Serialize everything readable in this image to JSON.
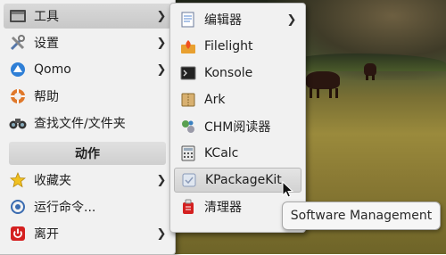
{
  "main_menu": {
    "items": [
      {
        "label": "工具",
        "icon": "tools-icon",
        "submenu": true
      },
      {
        "label": "设置",
        "icon": "settings-icon",
        "submenu": true
      },
      {
        "label": "Qomo",
        "icon": "qomo-icon",
        "submenu": true
      },
      {
        "label": "帮助",
        "icon": "help-icon",
        "submenu": false
      },
      {
        "label": "查找文件/文件夹",
        "icon": "binoculars-icon",
        "submenu": false
      }
    ],
    "section_header": "动作",
    "actions": [
      {
        "label": "收藏夹",
        "icon": "star-icon",
        "submenu": true
      },
      {
        "label": "运行命令...",
        "icon": "run-icon",
        "submenu": false
      },
      {
        "label": "离开",
        "icon": "power-icon",
        "submenu": true
      }
    ]
  },
  "tools_submenu": {
    "items": [
      {
        "label": "编辑器",
        "icon": "editor-icon",
        "submenu": true
      },
      {
        "label": "Filelight",
        "icon": "filelight-icon",
        "submenu": false
      },
      {
        "label": "Konsole",
        "icon": "terminal-icon",
        "submenu": false
      },
      {
        "label": "Ark",
        "icon": "archive-icon",
        "submenu": false
      },
      {
        "label": "CHM阅读器",
        "icon": "chm-reader-icon",
        "submenu": false
      },
      {
        "label": "KCalc",
        "icon": "calculator-icon",
        "submenu": false
      },
      {
        "label": "KPackageKit",
        "icon": "package-icon",
        "submenu": false
      },
      {
        "label": "清理器",
        "icon": "cleaner-icon",
        "submenu": false
      }
    ]
  },
  "tooltip": {
    "text": "Software Management"
  },
  "colors": {
    "menu_bg": "#f1f1f1",
    "selection": "#cfcfcf",
    "power_red": "#d42020",
    "star_yellow": "#f0c020"
  }
}
